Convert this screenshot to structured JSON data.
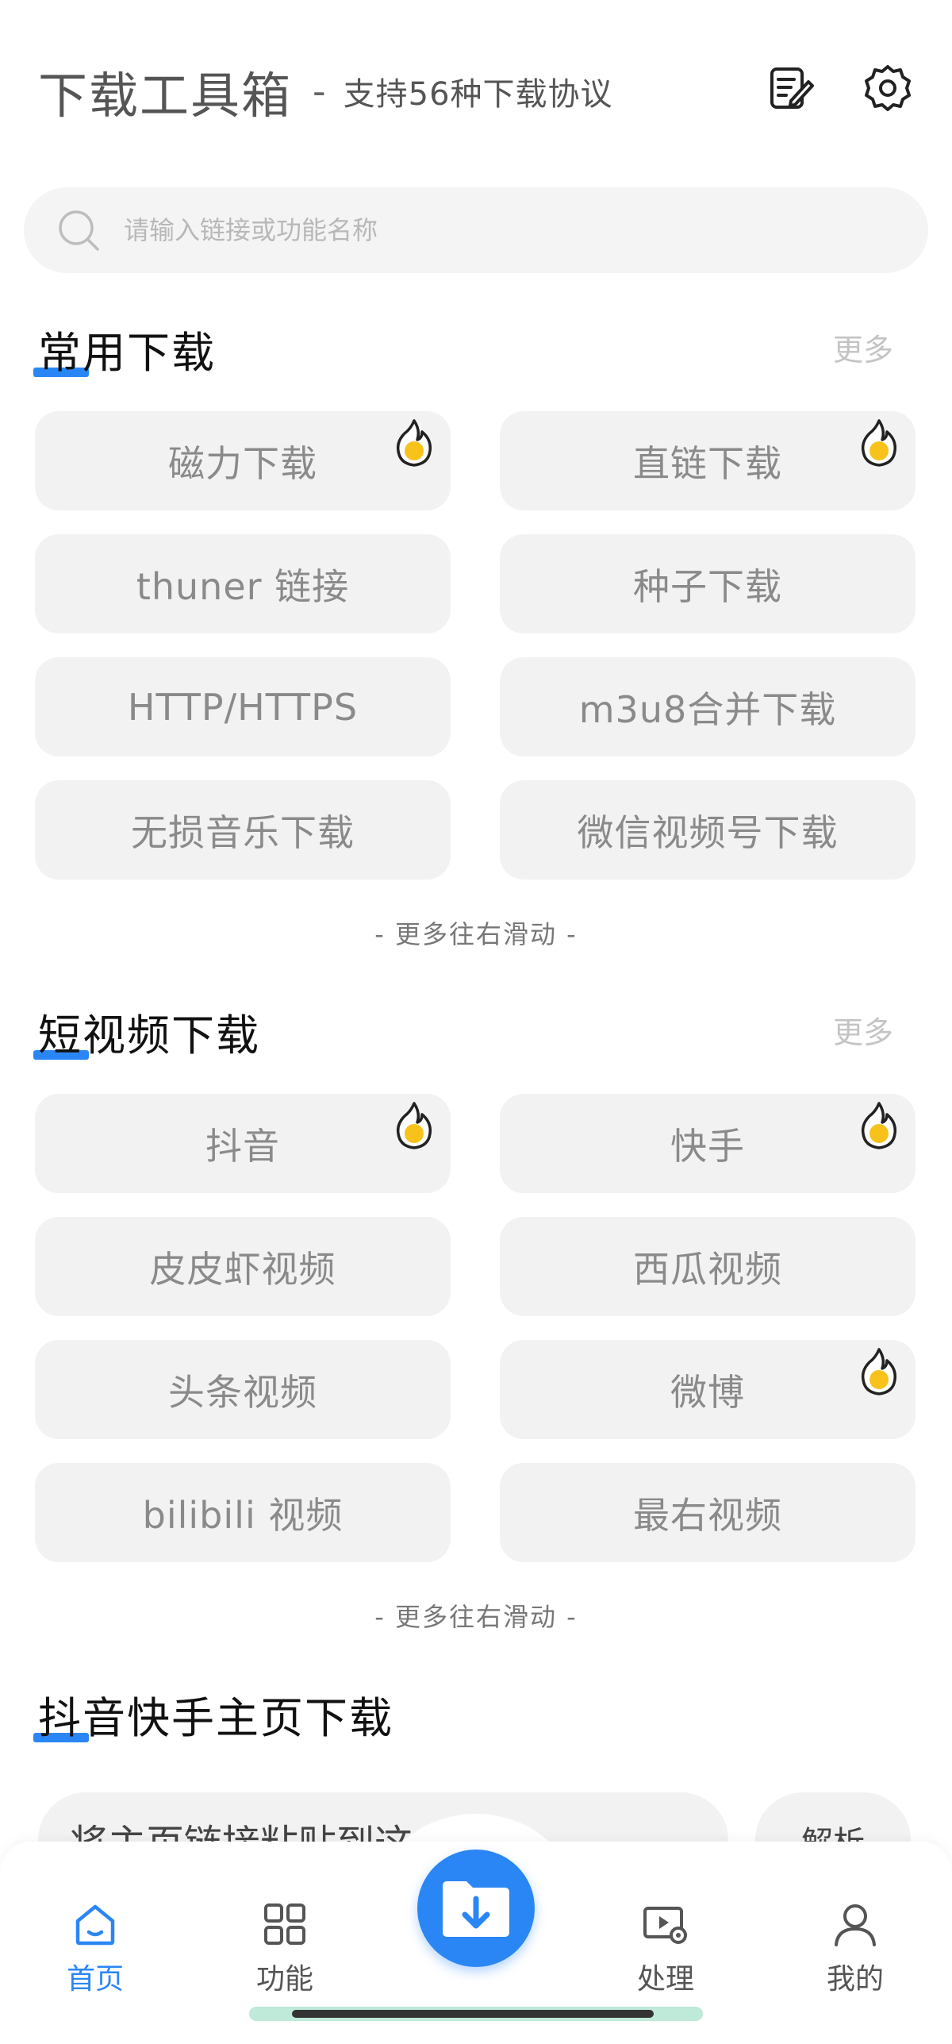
{
  "header": {
    "title": "下载工具箱",
    "separator": "-",
    "subtitle": "支持56种下载协议"
  },
  "search": {
    "placeholder": "请输入链接或功能名称"
  },
  "sections": {
    "common": {
      "title": "常用下载",
      "more": "更多",
      "hint": "- 更多往右滑动 -",
      "items": [
        {
          "label": "磁力下载",
          "hot": true
        },
        {
          "label": "直链下载",
          "hot": true
        },
        {
          "label": "thuner 链接",
          "hot": false
        },
        {
          "label": "种子下载",
          "hot": false
        },
        {
          "label": "HTTP/HTTPS",
          "hot": false
        },
        {
          "label": "m3u8合并下载",
          "hot": false
        },
        {
          "label": "无损音乐下载",
          "hot": false
        },
        {
          "label": "微信视频号下载",
          "hot": false
        }
      ]
    },
    "short_video": {
      "title": "短视频下载",
      "more": "更多",
      "hint": "- 更多往右滑动 -",
      "items": [
        {
          "label": "抖音",
          "hot": true
        },
        {
          "label": "快手",
          "hot": true
        },
        {
          "label": "皮皮虾视频",
          "hot": false
        },
        {
          "label": "西瓜视频",
          "hot": false
        },
        {
          "label": "头条视频",
          "hot": false
        },
        {
          "label": "微博",
          "hot": true
        },
        {
          "label": "bilibili 视频",
          "hot": false
        },
        {
          "label": "最右视频",
          "hot": false
        }
      ]
    },
    "homepage": {
      "title": "抖音快手主页下载",
      "input_text": "将主页链接粘贴到这",
      "parse_label": "解析"
    }
  },
  "tabbar": {
    "home": "首页",
    "features": "功能",
    "process": "处理",
    "mine": "我的"
  },
  "colors": {
    "accent": "#2b86f5",
    "hot_fill": "#f7c21a"
  }
}
